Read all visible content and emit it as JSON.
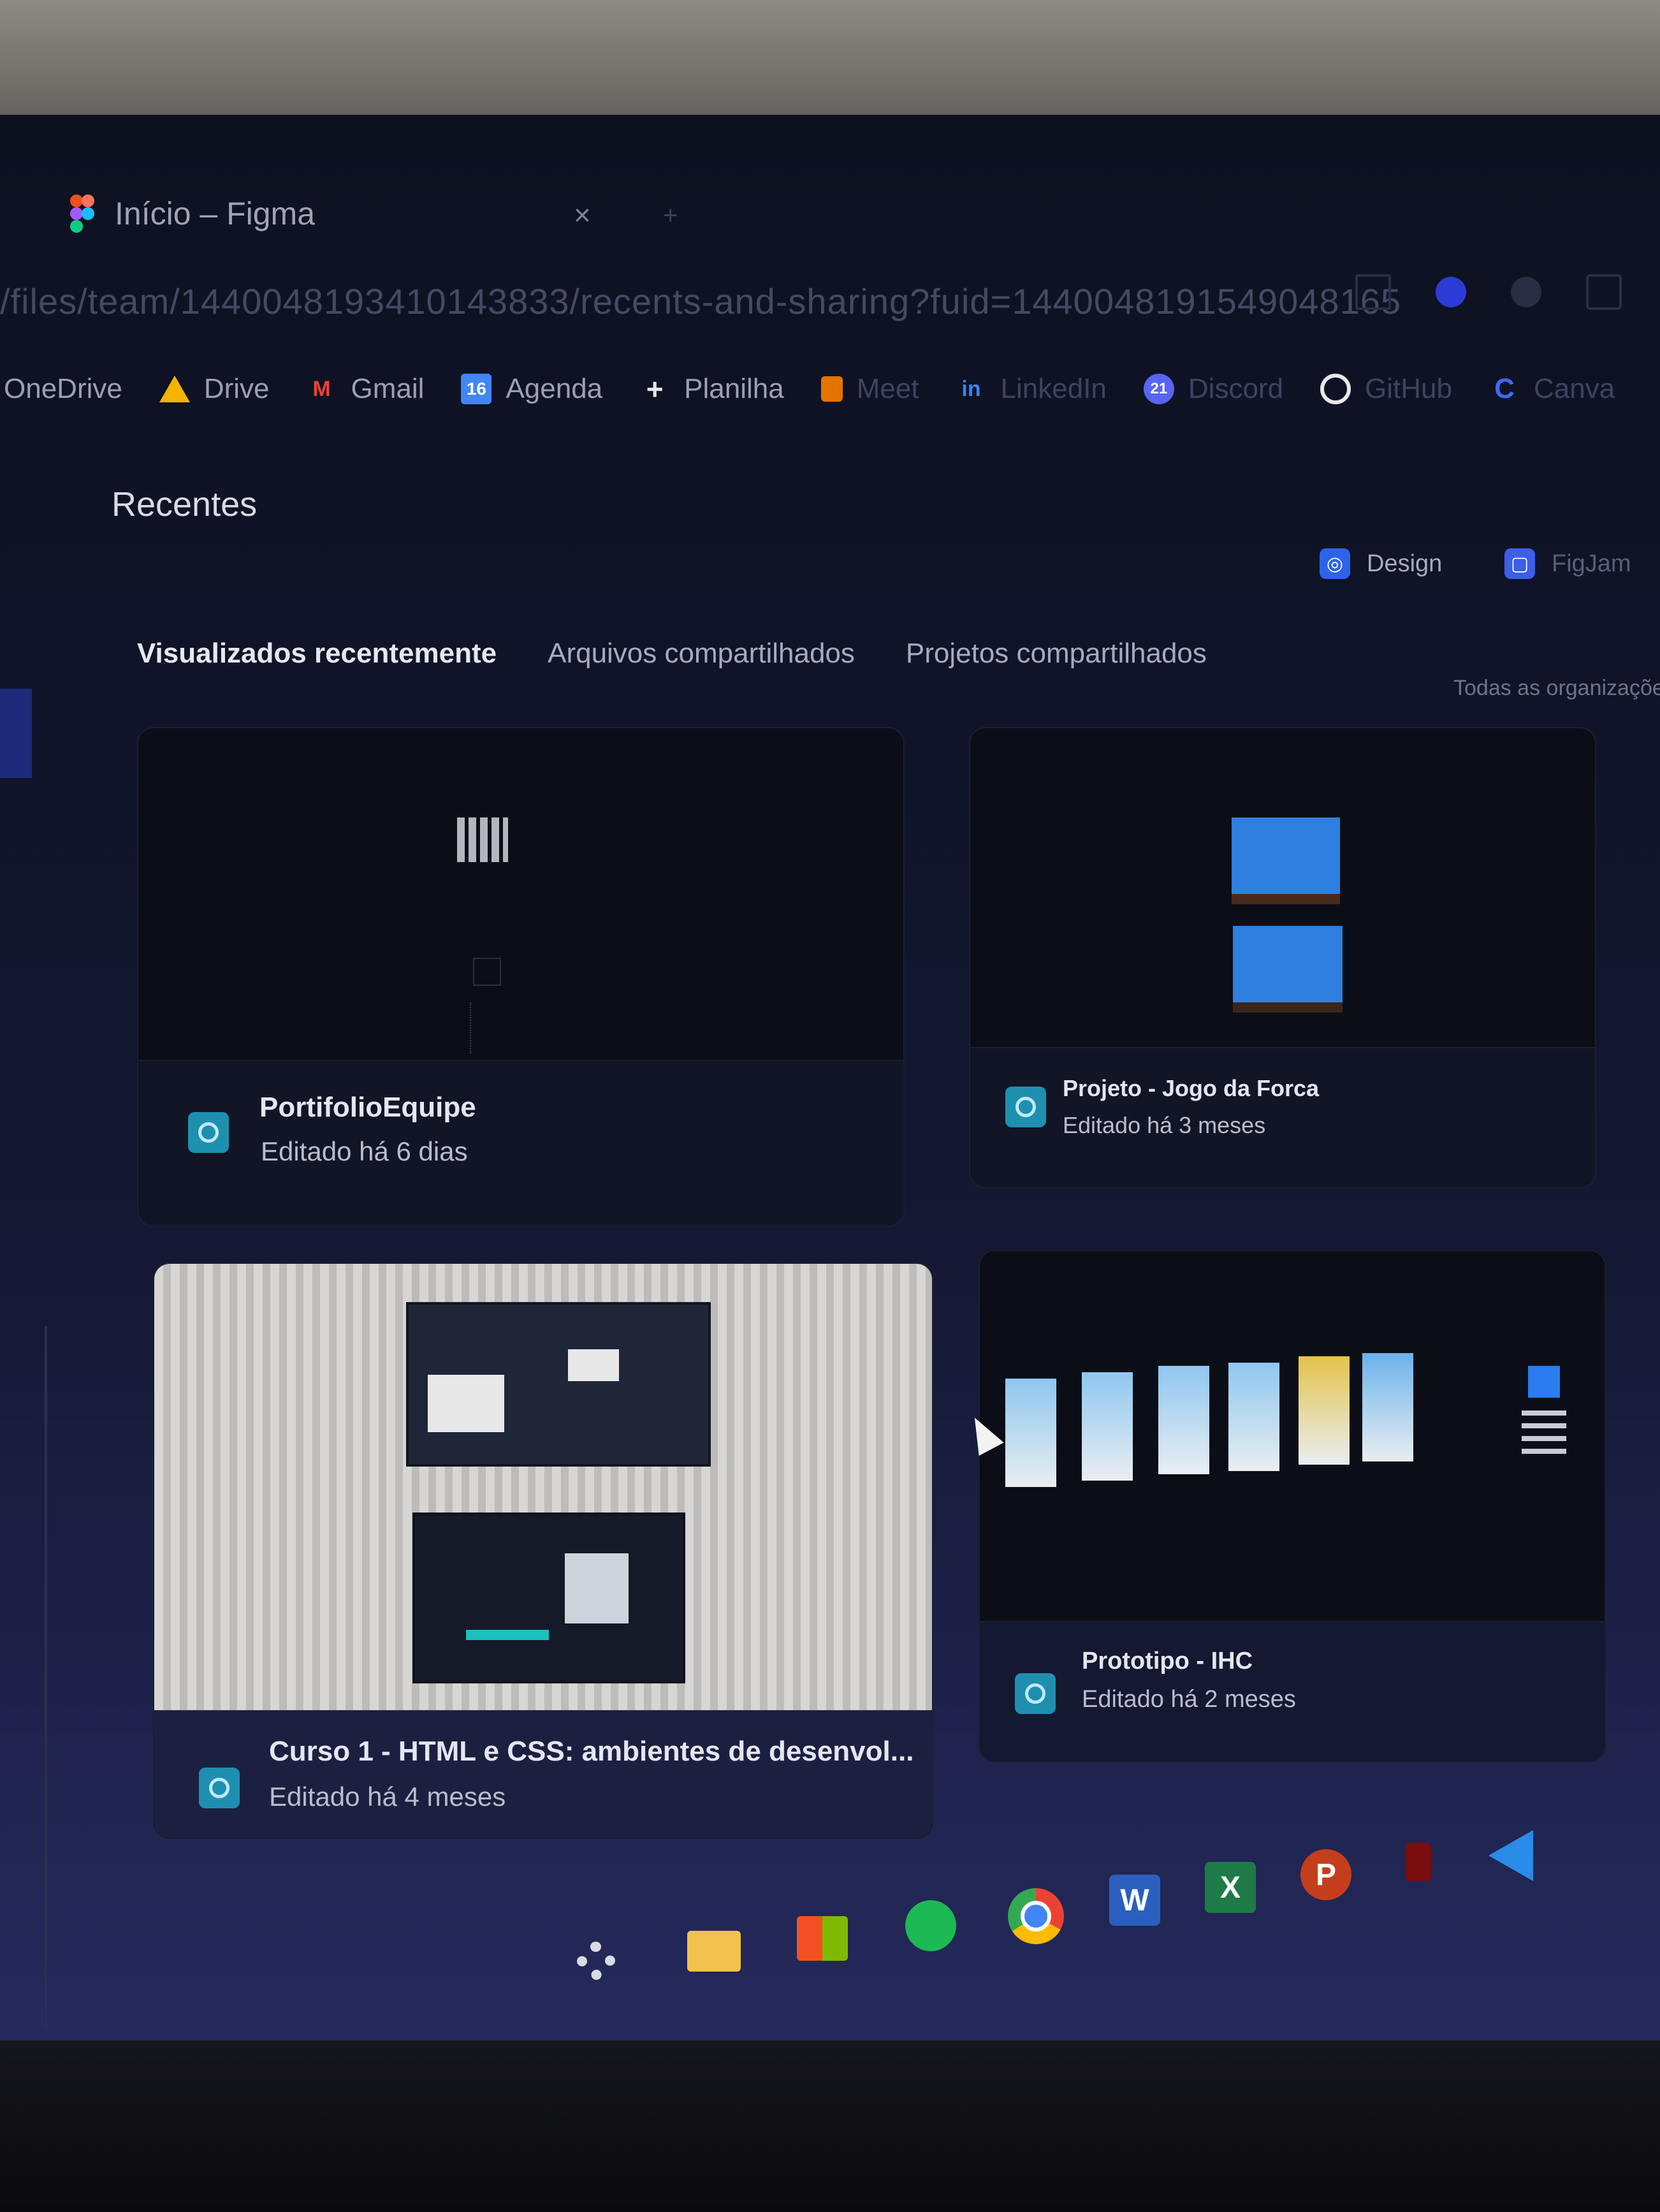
{
  "browser": {
    "tab_title": "Início – Figma",
    "tab_close": "×",
    "tab_new": "+",
    "url": "/files/team/1440048193410143833/recents-and-sharing?fuid=1440048191549048165"
  },
  "bookmarks": [
    {
      "label": "OneDrive",
      "icon": "cloud-icon",
      "color": "#9aa0b5"
    },
    {
      "label": "Drive",
      "icon": "google-drive-icon",
      "color": "#f4b400"
    },
    {
      "label": "Gmail",
      "icon": "gmail-icon",
      "color": "#ea4335"
    },
    {
      "label": "Agenda",
      "icon": "calendar-icon",
      "glyph": "16",
      "color": "#4285f4"
    },
    {
      "label": "Planilha",
      "icon": "sheets-icon",
      "glyph": "+",
      "color": "#e8e8e8"
    },
    {
      "label": "Meet",
      "icon": "meet-icon",
      "color": "#e37400"
    },
    {
      "label": "LinkedIn",
      "icon": "linkedin-icon",
      "glyph": "in",
      "color": "#3b82f6"
    },
    {
      "label": "Discord",
      "icon": "discord-icon",
      "glyph": "21",
      "color": "#5865f2"
    },
    {
      "label": "GitHub",
      "icon": "github-icon",
      "color": "#e8e8e8"
    },
    {
      "label": "Canva",
      "icon": "canva-icon",
      "glyph": "C",
      "color": "#3b6cf6"
    }
  ],
  "page": {
    "title": "Recentes",
    "create_design": "Design",
    "create_figjam": "FigJam",
    "tabs": [
      "Visualizados recentemente",
      "Arquivos compartilhados",
      "Projetos compartilhados"
    ],
    "org_filter": "Todas as organizações"
  },
  "files": [
    {
      "name": "PortifolioEquipe",
      "edited": "Editado há 6 dias"
    },
    {
      "name": "Projeto - Jogo da Forca",
      "edited": "Editado há 3 meses"
    },
    {
      "name": "Curso 1 - HTML e CSS: ambientes de desenvol...",
      "edited": "Editado há 4 meses"
    },
    {
      "name": "Prototipo - IHC",
      "edited": "Editado há 2 meses"
    }
  ],
  "taskbar": [
    {
      "name": "settings",
      "icon": "gear-icon"
    },
    {
      "name": "file-explorer",
      "icon": "folder-icon"
    },
    {
      "name": "microsoft-store",
      "icon": "store-icon"
    },
    {
      "name": "spotify",
      "icon": "spotify-icon"
    },
    {
      "name": "chrome",
      "icon": "chrome-icon"
    },
    {
      "name": "word",
      "icon": "word-icon",
      "glyph": "W"
    },
    {
      "name": "excel",
      "icon": "excel-icon",
      "glyph": "X"
    },
    {
      "name": "powerpoint",
      "icon": "powerpoint-icon",
      "glyph": "P"
    },
    {
      "name": "acrobat",
      "icon": "acrobat-icon"
    },
    {
      "name": "vscode",
      "icon": "vscode-icon"
    }
  ],
  "colors": {
    "background": "#0e1120",
    "figma_file_icon": "#1f8fb0",
    "active_tab_text": "#e6e8ef"
  }
}
